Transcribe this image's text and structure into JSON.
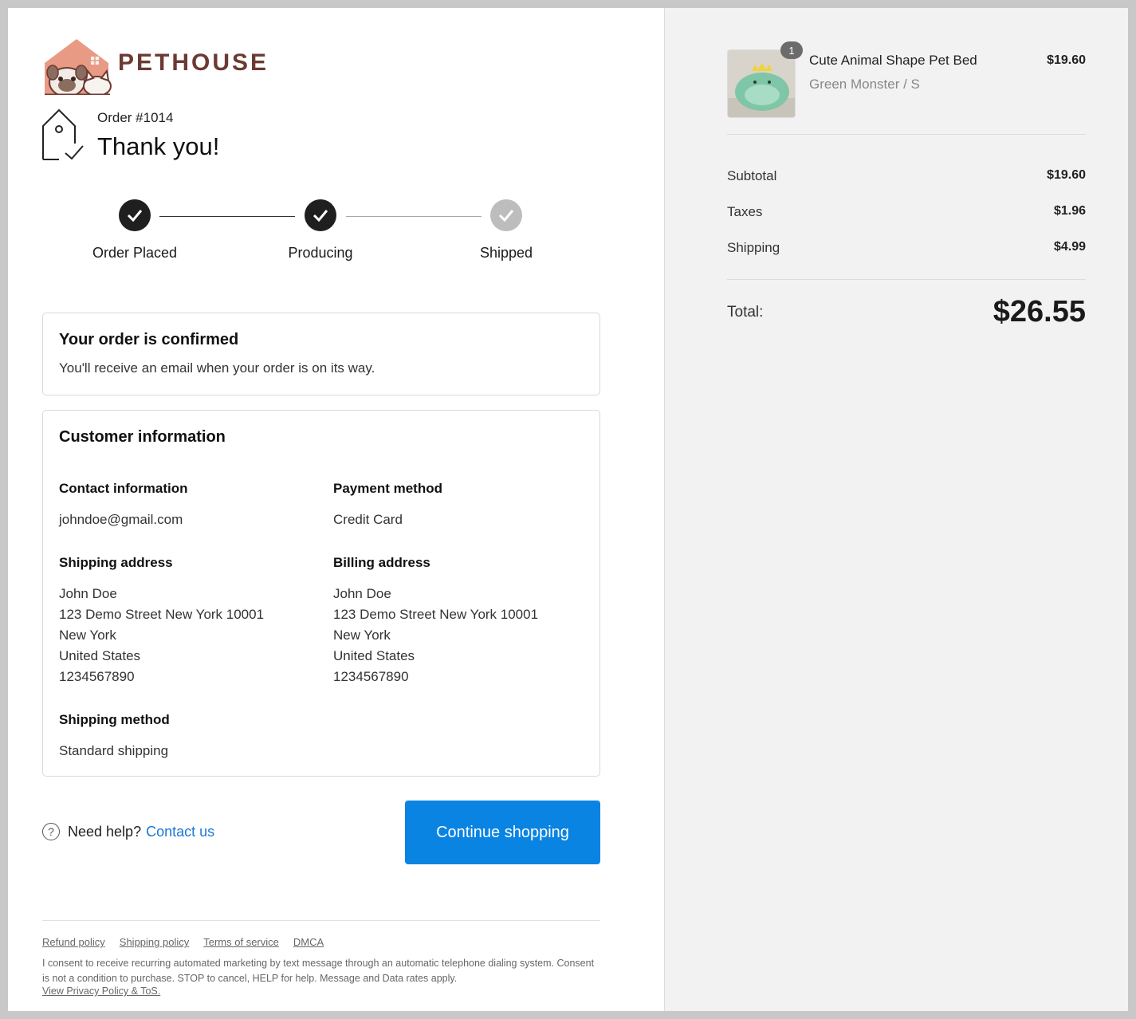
{
  "brand": {
    "name": "PETHOUSE",
    "primary_color": "#6b3a33",
    "roof_color": "#e89a85"
  },
  "order": {
    "number": "Order #1014",
    "title": "Thank you!"
  },
  "progress": {
    "steps": [
      {
        "label": "Order Placed",
        "state": "done"
      },
      {
        "label": "Producing",
        "state": "done"
      },
      {
        "label": "Shipped",
        "state": "pending"
      }
    ]
  },
  "confirmation": {
    "title": "Your order is confirmed",
    "text": "You'll receive an email when your order is on its way."
  },
  "customer": {
    "title": "Customer information",
    "contact": {
      "heading": "Contact information",
      "email": "johndoe@gmail.com"
    },
    "payment": {
      "heading": "Payment method",
      "method": "Credit Card"
    },
    "shipping_address": {
      "heading": "Shipping address",
      "lines": [
        "John Doe",
        "123 Demo Street New York 10001",
        "New York",
        "United States",
        "1234567890"
      ]
    },
    "billing_address": {
      "heading": "Billing address",
      "lines": [
        "John Doe",
        "123 Demo Street New York 10001",
        "New York",
        "United States",
        "1234567890"
      ]
    },
    "shipping_method": {
      "heading": "Shipping method",
      "method": "Standard shipping"
    }
  },
  "help": {
    "text": "Need help?",
    "link": "Contact us"
  },
  "continue_button": {
    "label": "Continue shopping",
    "color": "#0a84e3"
  },
  "footer": {
    "links": [
      "Refund policy",
      "Shipping policy",
      "Terms of service",
      "DMCA"
    ],
    "consent": "I consent to receive recurring automated marketing by text message through an automatic telephone dialing system. Consent is not a condition to purchase. STOP to cancel, HELP for help. Message and Data rates apply.",
    "privacy_link": "View Privacy Policy & ToS."
  },
  "cart": {
    "item": {
      "name": "Cute Animal Shape Pet Bed",
      "variant": "Green Monster / S",
      "price": "$19.60",
      "quantity": "1"
    },
    "subtotal": {
      "label": "Subtotal",
      "value": "$19.60"
    },
    "taxes": {
      "label": "Taxes",
      "value": "$1.96"
    },
    "shipping": {
      "label": "Shipping",
      "value": "$4.99"
    },
    "total": {
      "label": "Total:",
      "value": "$26.55"
    }
  }
}
